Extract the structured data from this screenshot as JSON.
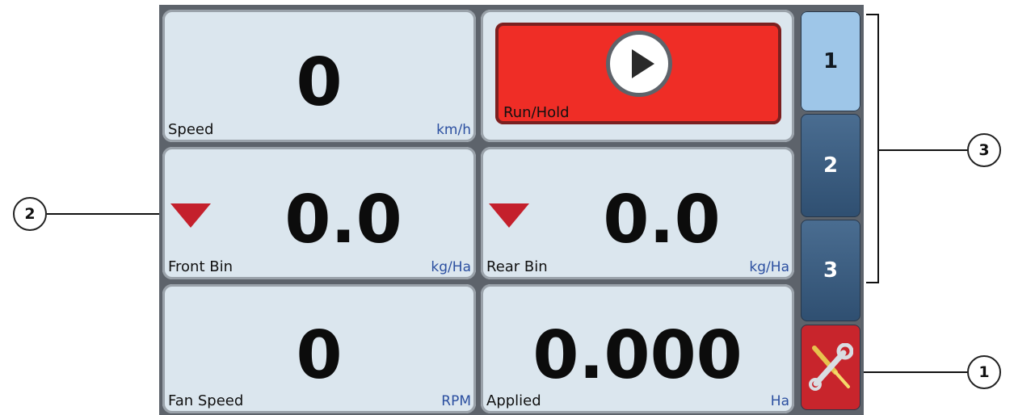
{
  "tiles": {
    "speed": {
      "value": "0",
      "label": "Speed",
      "unit": "km/h"
    },
    "run_hold": {
      "label": "Run/Hold"
    },
    "front_bin": {
      "value": "0.0",
      "label": "Front Bin",
      "unit": "kg/Ha"
    },
    "rear_bin": {
      "value": "0.0",
      "label": "Rear Bin",
      "unit": "kg/Ha"
    },
    "fan_speed": {
      "value": "0",
      "label": "Fan Speed",
      "unit": "RPM"
    },
    "applied": {
      "value": "0.000",
      "label": "Applied",
      "unit": "Ha"
    }
  },
  "tabs": [
    {
      "label": "1",
      "active": true
    },
    {
      "label": "2",
      "active": false
    },
    {
      "label": "3",
      "active": false
    }
  ],
  "tools_icon": "wrench-screwdriver-icon",
  "callouts": {
    "one": "1",
    "two": "2",
    "three": "3"
  },
  "colors": {
    "run_button": "#ef2d26",
    "tile_bg": "#dbe6ee",
    "tab_active": "#9ec6e8",
    "tab_inactive": "#3a5c80",
    "tools_bg": "#c8252c",
    "indicator_triangle": "#c4202c",
    "unit_text": "#2b4fa0"
  }
}
